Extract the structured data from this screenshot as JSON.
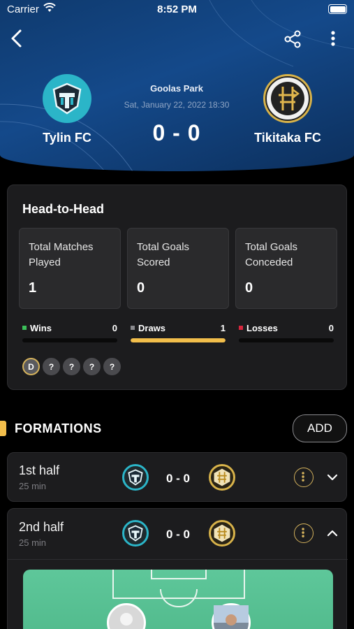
{
  "status_bar": {
    "carrier": "Carrier",
    "time": "8:52 PM"
  },
  "header_icons": {
    "back": "back-arrow-icon",
    "share": "share-icon",
    "more": "more-vertical-icon"
  },
  "match": {
    "venue": "Goolas Park",
    "datetime": "Sat, January 22, 2022 18:30",
    "score": "0 - 0",
    "home_team": "Tylin FC",
    "away_team": "Tikitaka FC"
  },
  "head_to_head": {
    "title": "Head-to-Head",
    "stats": [
      {
        "label": "Total Matches Played",
        "value": "1"
      },
      {
        "label": "Total Goals Scored",
        "value": "0"
      },
      {
        "label": "Total Goals Conceded",
        "value": "0"
      }
    ],
    "results": [
      {
        "label": "Wins",
        "count": "0",
        "color": "#3cc05a",
        "fraction": 0
      },
      {
        "label": "Draws",
        "count": "1",
        "color": "#8a8a8e",
        "fraction": 1,
        "bar_color": "#f2be4b"
      },
      {
        "label": "Losses",
        "count": "0",
        "color": "#d7263d",
        "fraction": 0
      }
    ],
    "recent_form": [
      "D",
      "?",
      "?",
      "?",
      "?"
    ]
  },
  "formations": {
    "title": "FORMATIONS",
    "add_label": "ADD",
    "halves": [
      {
        "name": "1st half",
        "duration": "25 min",
        "score": "0 - 0",
        "expanded": false
      },
      {
        "name": "2nd half",
        "duration": "25 min",
        "score": "0 - 0",
        "expanded": true
      }
    ]
  }
}
